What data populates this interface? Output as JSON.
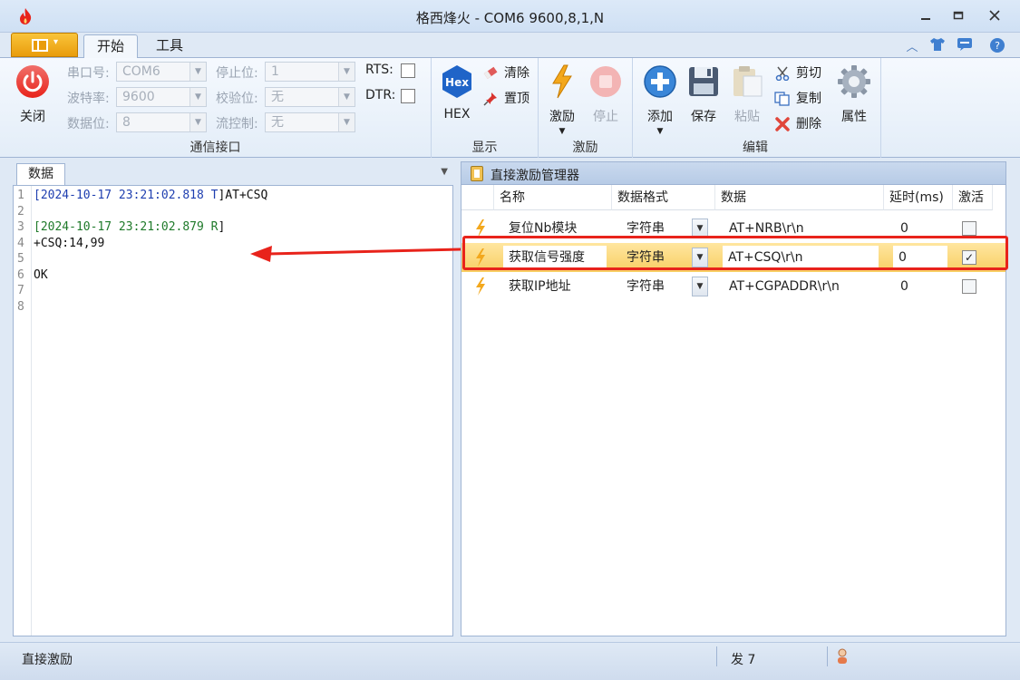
{
  "window": {
    "title": "格西烽火 - COM6  9600,8,1,N",
    "controls": [
      "minimize",
      "restore",
      "close"
    ]
  },
  "ribbon_tabs": [
    {
      "label": "开始",
      "active": true
    },
    {
      "label": "工具",
      "active": false
    }
  ],
  "ribbon": {
    "comm_group": {
      "label": "通信接口",
      "close_button": "关闭",
      "fields": {
        "port_label": "串口号:",
        "port_value": "COM6",
        "baud_label": "波特率:",
        "baud_value": "9600",
        "databits_label": "数据位:",
        "databits_value": "8",
        "stopbits_label": "停止位:",
        "stopbits_value": "1",
        "parity_label": "校验位:",
        "parity_value": "无",
        "flow_label": "流控制:",
        "flow_value": "无"
      },
      "rts_label": "RTS:",
      "dtr_label": "DTR:"
    },
    "display_group": {
      "label": "显示",
      "hex_icon_text": "Hex",
      "hex_button": "HEX",
      "clear_button": "清除",
      "top_button": "置顶"
    },
    "stimulus_group": {
      "label": "激励",
      "stimulus_button": "激励",
      "stop_button": "停止"
    },
    "edit_group": {
      "label": "编辑",
      "add_button": "添加",
      "save_button": "保存",
      "paste_button": "粘贴",
      "cut_button": "剪切",
      "copy_button": "复制",
      "delete_button": "删除",
      "props_button": "属性"
    }
  },
  "data_panel": {
    "tab_label": "数据",
    "lines": [
      {
        "no": "1",
        "parts": [
          {
            "text": "[2024-10-17 23:21:02.818 T",
            "color": "blue"
          },
          {
            "text": "]AT+CSQ",
            "color": "black"
          }
        ]
      },
      {
        "no": "2",
        "parts": []
      },
      {
        "no": "3",
        "parts": [
          {
            "text": "[2024-10-17 23:21:02.879 R",
            "color": "green"
          },
          {
            "text": "]",
            "color": "black"
          }
        ]
      },
      {
        "no": "4",
        "parts": [
          {
            "text": "+CSQ:14,99",
            "color": "black"
          }
        ]
      },
      {
        "no": "5",
        "parts": []
      },
      {
        "no": "6",
        "parts": [
          {
            "text": "OK",
            "color": "black"
          }
        ]
      },
      {
        "no": "7",
        "parts": []
      },
      {
        "no": "8",
        "parts": []
      }
    ]
  },
  "stimulus_manager": {
    "title": "直接激励管理器",
    "columns": [
      "名称",
      "数据格式",
      "数据",
      "延时(ms)",
      "激活"
    ],
    "rows": [
      {
        "name": "复位Nb模块",
        "format": "字符串",
        "data": "AT+NRB\\r\\n",
        "delay": "0",
        "active": false,
        "selected": false
      },
      {
        "name": "获取信号强度",
        "format": "字符串",
        "data": "AT+CSQ\\r\\n",
        "delay": "0",
        "active": true,
        "selected": true
      },
      {
        "name": "获取IP地址",
        "format": "字符串",
        "data": "AT+CGPADDR\\r\\n",
        "delay": "0",
        "active": false,
        "selected": false
      }
    ]
  },
  "status": {
    "left": "直接激励",
    "send": "发 7"
  },
  "colors": {
    "accent_orange": "#e99c0c",
    "highlight_red": "#e8231b",
    "selection_yellow": "#f8cf63",
    "ribbon_blue": "#dfe9f5"
  }
}
